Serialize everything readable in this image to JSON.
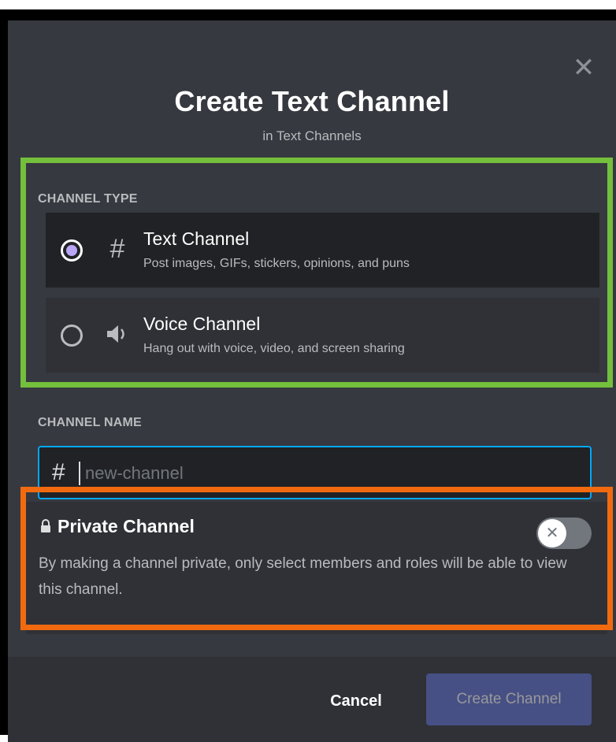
{
  "dialog": {
    "title": "Create Text Channel",
    "subtitle": "in Text Channels",
    "close_icon": "close-icon"
  },
  "channel_type": {
    "label": "CHANNEL TYPE",
    "options": [
      {
        "title": "Text Channel",
        "description": "Post images, GIFs, stickers, opinions, and puns",
        "icon": "hash-icon",
        "selected": true
      },
      {
        "title": "Voice Channel",
        "description": "Hang out with voice, video, and screen sharing",
        "icon": "speaker-icon",
        "selected": false
      }
    ]
  },
  "channel_name": {
    "label": "CHANNEL NAME",
    "prefix": "#",
    "value": "",
    "placeholder": "new-channel"
  },
  "private": {
    "title": "Private Channel",
    "description": "By making a channel private, only select members and roles will be able to view this channel.",
    "enabled": false,
    "icon": "lock-icon"
  },
  "footer": {
    "cancel_label": "Cancel",
    "create_label": "Create Channel"
  },
  "colors": {
    "modal_bg": "#36393f",
    "option_selected_bg": "#202225",
    "highlight_green": "#74bf3c",
    "highlight_orange": "#f26a0f",
    "input_focus_border": "#00a8fc",
    "brand_button": "#5865b8"
  }
}
